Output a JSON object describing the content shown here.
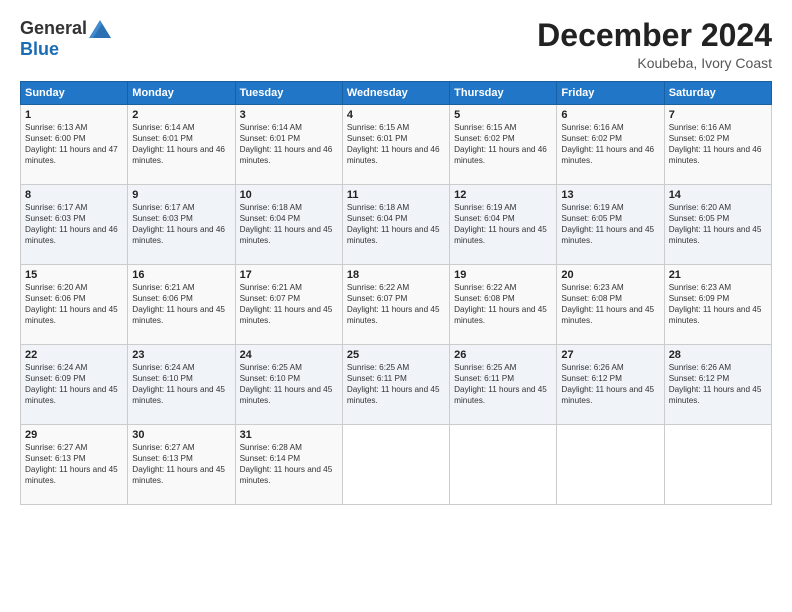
{
  "logo": {
    "general": "General",
    "blue": "Blue"
  },
  "header": {
    "title": "December 2024",
    "subtitle": "Koubeba, Ivory Coast"
  },
  "weekdays": [
    "Sunday",
    "Monday",
    "Tuesday",
    "Wednesday",
    "Thursday",
    "Friday",
    "Saturday"
  ],
  "weeks": [
    [
      {
        "day": "1",
        "sunrise": "6:13 AM",
        "sunset": "6:00 PM",
        "daylight": "11 hours and 47 minutes."
      },
      {
        "day": "2",
        "sunrise": "6:14 AM",
        "sunset": "6:01 PM",
        "daylight": "11 hours and 46 minutes."
      },
      {
        "day": "3",
        "sunrise": "6:14 AM",
        "sunset": "6:01 PM",
        "daylight": "11 hours and 46 minutes."
      },
      {
        "day": "4",
        "sunrise": "6:15 AM",
        "sunset": "6:01 PM",
        "daylight": "11 hours and 46 minutes."
      },
      {
        "day": "5",
        "sunrise": "6:15 AM",
        "sunset": "6:02 PM",
        "daylight": "11 hours and 46 minutes."
      },
      {
        "day": "6",
        "sunrise": "6:16 AM",
        "sunset": "6:02 PM",
        "daylight": "11 hours and 46 minutes."
      },
      {
        "day": "7",
        "sunrise": "6:16 AM",
        "sunset": "6:02 PM",
        "daylight": "11 hours and 46 minutes."
      }
    ],
    [
      {
        "day": "8",
        "sunrise": "6:17 AM",
        "sunset": "6:03 PM",
        "daylight": "11 hours and 46 minutes."
      },
      {
        "day": "9",
        "sunrise": "6:17 AM",
        "sunset": "6:03 PM",
        "daylight": "11 hours and 46 minutes."
      },
      {
        "day": "10",
        "sunrise": "6:18 AM",
        "sunset": "6:04 PM",
        "daylight": "11 hours and 45 minutes."
      },
      {
        "day": "11",
        "sunrise": "6:18 AM",
        "sunset": "6:04 PM",
        "daylight": "11 hours and 45 minutes."
      },
      {
        "day": "12",
        "sunrise": "6:19 AM",
        "sunset": "6:04 PM",
        "daylight": "11 hours and 45 minutes."
      },
      {
        "day": "13",
        "sunrise": "6:19 AM",
        "sunset": "6:05 PM",
        "daylight": "11 hours and 45 minutes."
      },
      {
        "day": "14",
        "sunrise": "6:20 AM",
        "sunset": "6:05 PM",
        "daylight": "11 hours and 45 minutes."
      }
    ],
    [
      {
        "day": "15",
        "sunrise": "6:20 AM",
        "sunset": "6:06 PM",
        "daylight": "11 hours and 45 minutes."
      },
      {
        "day": "16",
        "sunrise": "6:21 AM",
        "sunset": "6:06 PM",
        "daylight": "11 hours and 45 minutes."
      },
      {
        "day": "17",
        "sunrise": "6:21 AM",
        "sunset": "6:07 PM",
        "daylight": "11 hours and 45 minutes."
      },
      {
        "day": "18",
        "sunrise": "6:22 AM",
        "sunset": "6:07 PM",
        "daylight": "11 hours and 45 minutes."
      },
      {
        "day": "19",
        "sunrise": "6:22 AM",
        "sunset": "6:08 PM",
        "daylight": "11 hours and 45 minutes."
      },
      {
        "day": "20",
        "sunrise": "6:23 AM",
        "sunset": "6:08 PM",
        "daylight": "11 hours and 45 minutes."
      },
      {
        "day": "21",
        "sunrise": "6:23 AM",
        "sunset": "6:09 PM",
        "daylight": "11 hours and 45 minutes."
      }
    ],
    [
      {
        "day": "22",
        "sunrise": "6:24 AM",
        "sunset": "6:09 PM",
        "daylight": "11 hours and 45 minutes."
      },
      {
        "day": "23",
        "sunrise": "6:24 AM",
        "sunset": "6:10 PM",
        "daylight": "11 hours and 45 minutes."
      },
      {
        "day": "24",
        "sunrise": "6:25 AM",
        "sunset": "6:10 PM",
        "daylight": "11 hours and 45 minutes."
      },
      {
        "day": "25",
        "sunrise": "6:25 AM",
        "sunset": "6:11 PM",
        "daylight": "11 hours and 45 minutes."
      },
      {
        "day": "26",
        "sunrise": "6:25 AM",
        "sunset": "6:11 PM",
        "daylight": "11 hours and 45 minutes."
      },
      {
        "day": "27",
        "sunrise": "6:26 AM",
        "sunset": "6:12 PM",
        "daylight": "11 hours and 45 minutes."
      },
      {
        "day": "28",
        "sunrise": "6:26 AM",
        "sunset": "6:12 PM",
        "daylight": "11 hours and 45 minutes."
      }
    ],
    [
      {
        "day": "29",
        "sunrise": "6:27 AM",
        "sunset": "6:13 PM",
        "daylight": "11 hours and 45 minutes."
      },
      {
        "day": "30",
        "sunrise": "6:27 AM",
        "sunset": "6:13 PM",
        "daylight": "11 hours and 45 minutes."
      },
      {
        "day": "31",
        "sunrise": "6:28 AM",
        "sunset": "6:14 PM",
        "daylight": "11 hours and 45 minutes."
      },
      null,
      null,
      null,
      null
    ]
  ]
}
